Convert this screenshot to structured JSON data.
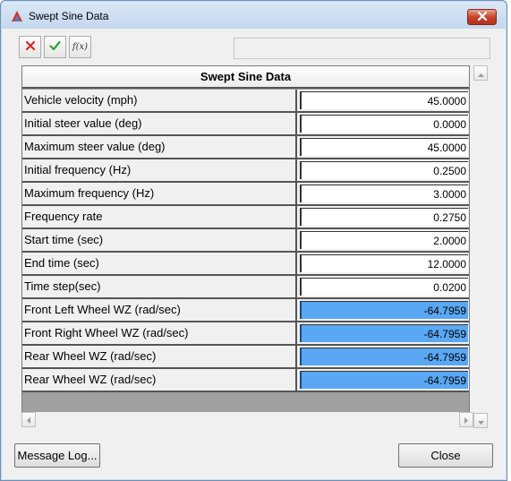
{
  "window": {
    "title": "Swept Sine Data",
    "app_icon": "altair-logo-icon",
    "close_icon": "close-icon"
  },
  "toolbar": {
    "reject_icon": "reject-x-icon",
    "accept_icon": "accept-check-icon",
    "fx_label": "f(x)",
    "fx_icon": "function-fx-icon",
    "expression_value": ""
  },
  "table": {
    "header": "Swept Sine Data",
    "rows": [
      {
        "label": "Vehicle velocity (mph)",
        "value": "45.0000",
        "highlighted": false
      },
      {
        "label": "Initial steer value (deg)",
        "value": "0.0000",
        "highlighted": false
      },
      {
        "label": "Maximum steer value (deg)",
        "value": "45.0000",
        "highlighted": false
      },
      {
        "label": "Initial frequency (Hz)",
        "value": "0.2500",
        "highlighted": false
      },
      {
        "label": "Maximum frequency (Hz)",
        "value": "3.0000",
        "highlighted": false
      },
      {
        "label": "Frequency rate",
        "value": "0.2750",
        "highlighted": false
      },
      {
        "label": "Start time (sec)",
        "value": "2.0000",
        "highlighted": false
      },
      {
        "label": "End time (sec)",
        "value": "12.0000",
        "highlighted": false
      },
      {
        "label": "Time step(sec)",
        "value": "0.0200",
        "highlighted": false
      },
      {
        "label": "Front Left Wheel WZ (rad/sec)",
        "value": "-64.7959",
        "highlighted": true
      },
      {
        "label": "Front Right Wheel WZ (rad/sec)",
        "value": "-64.7959",
        "highlighted": true
      },
      {
        "label": "Rear Wheel WZ (rad/sec)",
        "value": "-64.7959",
        "highlighted": true
      },
      {
        "label": "Rear Wheel WZ (rad/sec)",
        "value": "-64.7959",
        "highlighted": true
      }
    ],
    "highlight_color": "#5aa8f4"
  },
  "footer": {
    "message_log_label": "Message Log...",
    "close_label": "Close"
  }
}
